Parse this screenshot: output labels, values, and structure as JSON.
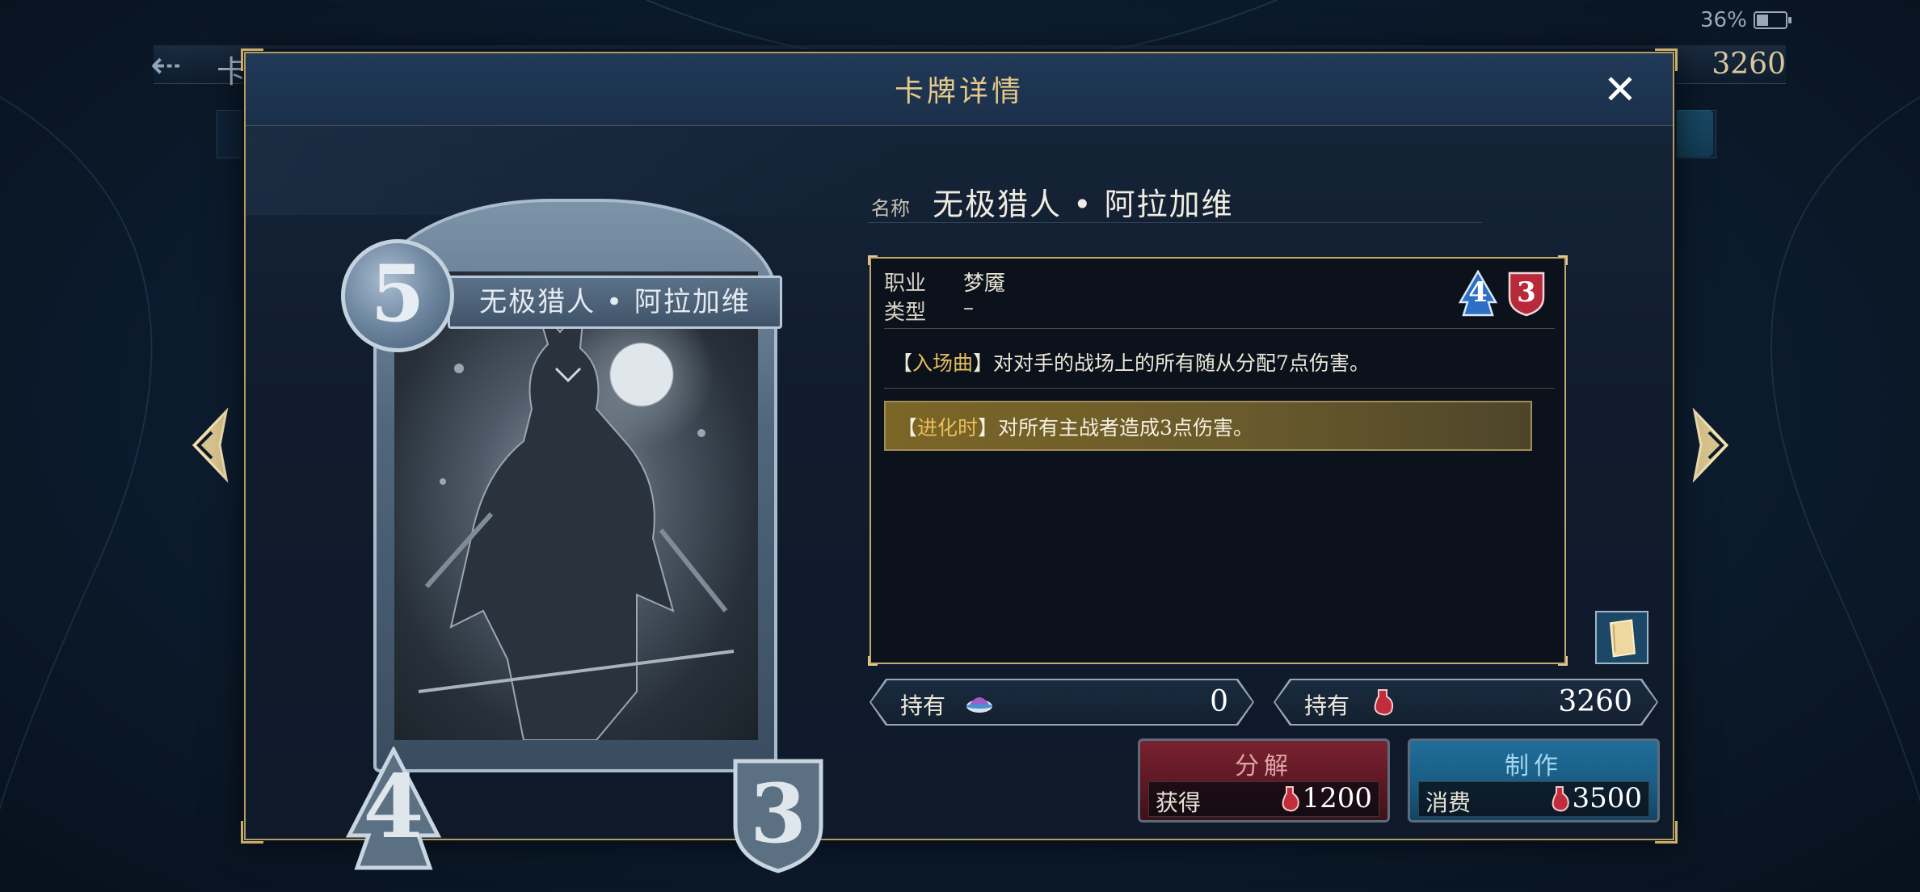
{
  "status": {
    "battery": "36%"
  },
  "background": {
    "title": "卡",
    "currency": "3260"
  },
  "modal": {
    "title": "卡牌详情",
    "close_symbol": "✕"
  },
  "card": {
    "name": "无极猎人 • 阿拉加维",
    "cost": "5",
    "attack": "4",
    "defense": "3"
  },
  "details": {
    "name_label": "名称",
    "name_value": "无极猎人 • 阿拉加维",
    "class_label": "职业",
    "class_value": "梦魇",
    "type_label": "类型",
    "type_value": "–",
    "evolved_attack": "4",
    "evolved_defense": "3",
    "fanfare_keyword": "入场曲",
    "fanfare_text": "对对手的战场上的所有随从分配7点伤害。",
    "evolve_keyword": "进化时",
    "evolve_text": "对所有主战者造成3点伤害。"
  },
  "owned": {
    "label": "持有",
    "cards_value": "0",
    "vials_value": "3260"
  },
  "actions": {
    "disenchant_label": "分解",
    "disenchant_sub_label": "获得",
    "disenchant_value": "1200",
    "craft_label": "制作",
    "craft_sub_label": "消费",
    "craft_value": "3500"
  },
  "icons": {
    "close": "close-icon",
    "prev": "chevron-left-icon",
    "next": "chevron-right-icon",
    "book": "book-icon",
    "card_pack": "card-pack-icon",
    "vial": "red-vial-icon"
  },
  "colors": {
    "gold_accent": "#c4a86c",
    "attack_gem": "#2c6fc4",
    "defense_gem": "#b8293a",
    "disenchant_button": "#7a2230",
    "craft_button": "#1f6f9b"
  }
}
